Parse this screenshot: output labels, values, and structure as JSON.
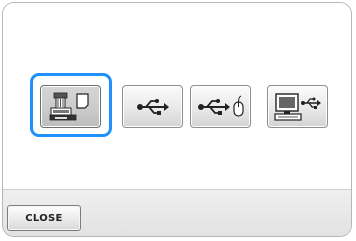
{
  "source_buttons": [
    {
      "id": "machine",
      "icon": "embroidery-machine-memory-icon",
      "selected": true
    },
    {
      "id": "usb",
      "icon": "usb-icon",
      "selected": false
    },
    {
      "id": "usb-mouse",
      "icon": "usb-mouse-port-icon",
      "selected": false
    },
    {
      "id": "computer",
      "icon": "computer-usb-icon",
      "selected": false
    }
  ],
  "footer": {
    "close_label": "CLOSE"
  },
  "colors": {
    "selection_ring": "#1e90ff",
    "button_border": "#8e8e8e",
    "icon_dark": "#333333"
  }
}
